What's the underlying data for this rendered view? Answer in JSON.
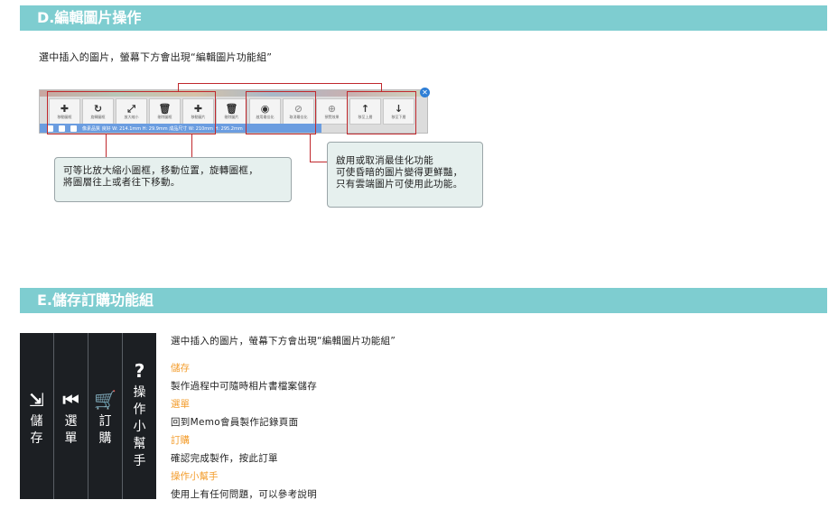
{
  "section_d": {
    "title": "D.編輯圖片操作",
    "intro": "選中插入的圖片，螢幕下方會出現“編輯圖片功能組”",
    "toolbar": {
      "buttons": [
        {
          "icon": "move-icon",
          "glyph": "✚",
          "label": "移動圖框"
        },
        {
          "icon": "rotate-icon",
          "glyph": "↻",
          "label": "旋轉圖框"
        },
        {
          "icon": "resize-icon",
          "glyph": "⤢",
          "label": "放大縮小"
        },
        {
          "icon": "trash-icon",
          "glyph": "🗑",
          "label": "刪除圖框"
        },
        {
          "icon": "move-icon",
          "glyph": "✚",
          "label": "移動圖片"
        },
        {
          "icon": "trash-icon",
          "glyph": "🗑",
          "label": "刪除圖片"
        },
        {
          "icon": "eye-icon",
          "glyph": "◉",
          "label": "啟用最佳化"
        },
        {
          "icon": "eye-off-icon",
          "glyph": "⊘",
          "label": "取消最佳化"
        },
        {
          "icon": "zoom-icon",
          "glyph": "⊕",
          "label": "預覽效果"
        },
        {
          "icon": "arrow-up-icon",
          "glyph": "↑",
          "label": "移至上層"
        },
        {
          "icon": "arrow-down-icon",
          "glyph": "↓",
          "label": "移至下層"
        }
      ],
      "status_text": "像素品質 良好 W: 214.1mm H: 29.9mm 成品尺寸 W: 210mm H: 295.2mm",
      "close_glyph": "✕"
    },
    "callout_left": [
      "可等比放大縮小圖框，移動位置，旋轉圖框，",
      "將圖層往上或者往下移動。"
    ],
    "callout_right": [
      "啟用或取消最佳化功能",
      "可使昏暗的圖片變得更鮮豔，",
      "只有雲端圖片可使用此功能。"
    ]
  },
  "section_e": {
    "title": "E.儲存訂購功能組",
    "intro": "選中插入的圖片，螢幕下方會出現“編輯圖片功能組”",
    "panel": [
      {
        "icon": "save-icon",
        "glyph": "⇲",
        "label": "儲存"
      },
      {
        "icon": "rewind-icon",
        "glyph": "⏮",
        "label": "選單"
      },
      {
        "icon": "cart-icon",
        "glyph": "🛒",
        "label": "訂購"
      },
      {
        "icon": "help-icon",
        "glyph": "?",
        "label": "操作小幫手"
      }
    ],
    "items": [
      {
        "heading": "儲存",
        "text": "製作過程中可隨時相片書檔案儲存"
      },
      {
        "heading": "選單",
        "text": "回到Memo會員製作記錄頁面"
      },
      {
        "heading": "訂購",
        "text": "確認完成製作，按此訂單"
      },
      {
        "heading": "操作小幫手",
        "text": "使用上有任何問題，可以參考說明"
      }
    ]
  },
  "colors": {
    "section_bar": "#7ecdd0",
    "highlight_red": "#c0282d",
    "heading_orange": "#f39c2b",
    "panel_bg": "#1c1f23"
  }
}
